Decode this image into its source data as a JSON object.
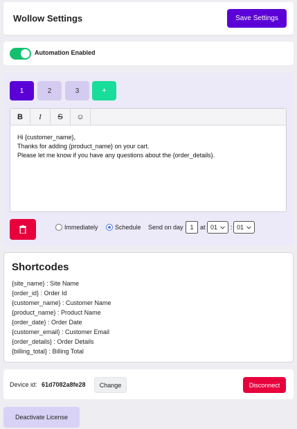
{
  "header": {
    "title": "Wollow Settings",
    "save_label": "Save Settings"
  },
  "automation": {
    "enabled": true,
    "label": "Automation Enabled"
  },
  "tabs": [
    {
      "label": "1",
      "active": true
    },
    {
      "label": "2",
      "active": false
    },
    {
      "label": "3",
      "active": false
    },
    {
      "label": "+",
      "active": false
    }
  ],
  "editor": {
    "toolbar": {
      "bold": "B",
      "italic": "I",
      "strike": "S",
      "emoji": "☺"
    },
    "lines": [
      "Hi {customer_name},",
      "Thanks for adding {product_name} on your cart.",
      "Please let me know if you have any questions about the {order_details}."
    ]
  },
  "schedule": {
    "immediately_label": "Immediately",
    "schedule_label": "Schedule",
    "selected": "Schedule",
    "send_on_day_label": "Send on day",
    "day_value": "1",
    "at_label": "at",
    "hour_value": "01",
    "colon": ":",
    "minute_value": "01"
  },
  "shortcodes": {
    "heading": "Shortcodes",
    "items": [
      "{site_name} : Site Name",
      "{order_id} : Order Id",
      "{customer_name} : Customer Name",
      "{product_name} : Product Name",
      "{order_date} : Order Date",
      "{customer_email} : Customer Email",
      "{order_details} : Order Details",
      "{billing_total} : Billing Total"
    ]
  },
  "device": {
    "label": "Device id:",
    "id": "61d7082a8fe28",
    "change_label": "Change",
    "disconnect_label": "Disconnect"
  },
  "license": {
    "deactivate_label": "Deactivate License"
  },
  "colors": {
    "primary": "#5b00d6",
    "danger": "#e8003d",
    "success": "#13c06e",
    "add": "#19dd9a"
  }
}
